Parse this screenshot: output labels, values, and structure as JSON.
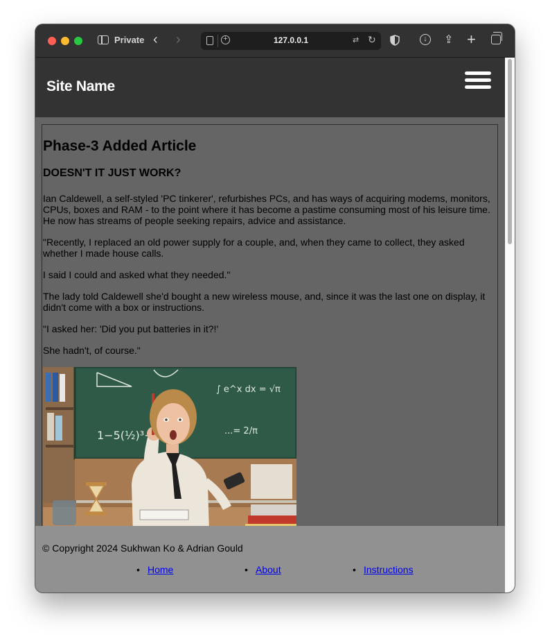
{
  "browser": {
    "private_label": "Private",
    "url": "127.0.0.1",
    "nav_back_glyph": "‹",
    "nav_forward_glyph": "›",
    "new_tab_glyph": "+",
    "reload_glyph": "↻",
    "translate_glyph": "⇄",
    "share_glyph": "⇪",
    "download_glyph": "↓",
    "plus_glyph": "+"
  },
  "site": {
    "name": "Site Name"
  },
  "article": {
    "title": "Phase-3 Added Article",
    "subtitle": "DOESN'T IT JUST WORK?",
    "paragraphs": [
      "Ian Caldewell, a self-styled 'PC tinkerer', refurbishes PCs, and has ways of acquiring modems, monitors, CPUs, boxes and RAM - to the point where it has become a pastime consuming most of his leisure time. He now has streams of people seeking repairs, advice and assistance.",
      "\"Recently, I replaced an old power supply for a couple, and, when they came to collect, they asked whether I made house calls.",
      "I said I could and asked what they needed.\"",
      "The lady told Caldewell she'd bought a new wireless mouse, and, since it was the last one on display, it didn't come with a box or instructions.",
      "\"I asked her: 'Did you put batteries in it?!'",
      "She hadn't, of course.\""
    ],
    "chalkboard": {
      "eq1": "1−5(½)³+(",
      "eq2": "∫ e^x dx = √π",
      "eq3": "...= 2/π"
    }
  },
  "footer": {
    "copyright": "© Copyright 2024 Sukhwan Ko & Adrian Gould",
    "links": [
      "Home",
      "About",
      "Instructions"
    ]
  },
  "colors": {
    "header_bg": "#333333",
    "main_bg": "#656565",
    "footer_bg": "#919191",
    "link": "#0000ee"
  }
}
